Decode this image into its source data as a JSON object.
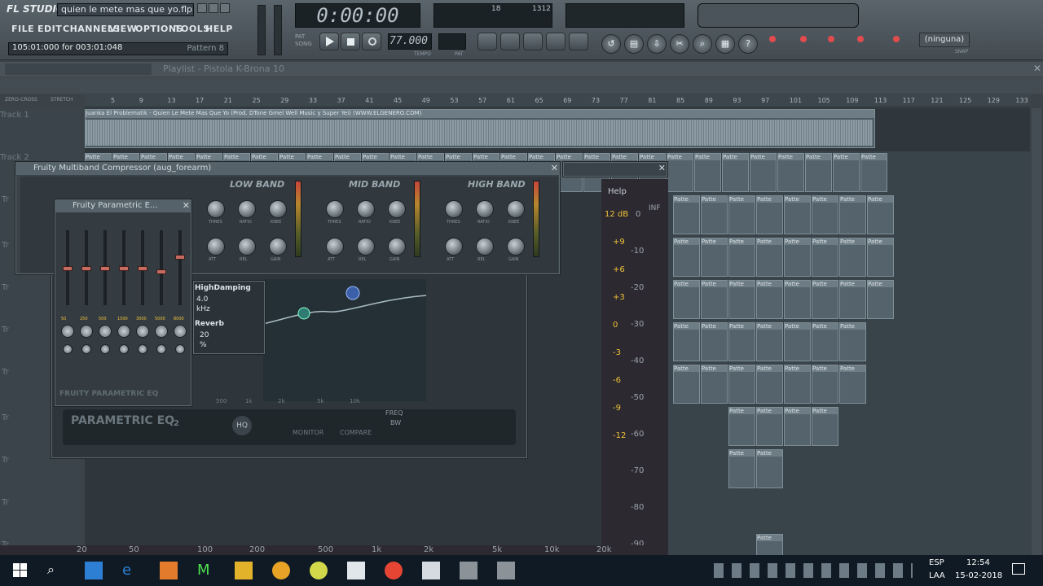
{
  "app": {
    "logo": "FL STUDIO",
    "project_file": "quien le mete mas que yo.flp",
    "time_status": "105:01:000 for 003:01:048",
    "pattern": "Pattern 8",
    "time_display": "0:00:00",
    "tempo": "77.000",
    "snap": "(ninguna)"
  },
  "menu": [
    "FILE",
    "EDIT",
    "CHANNELS",
    "VIEW",
    "OPTIONS",
    "TOOLS",
    "HELP"
  ],
  "mini": {
    "pat": "PAT",
    "song": "SONG",
    "tempo_lbl": "TEMPO",
    "pat_lbl": "PAT",
    "cpu1": "18",
    "cpu2": "1312",
    "snap_sub": "SNAP"
  },
  "playlist": {
    "title": "Playlist - Pistola K-Brona 10",
    "zero_cross": "ZERO-CROSS",
    "stretch": "STRETCH",
    "ruler": [
      "5",
      "9",
      "13",
      "17",
      "21",
      "25",
      "29",
      "33",
      "37",
      "41",
      "45",
      "49",
      "53",
      "57",
      "61",
      "65",
      "69",
      "73",
      "77",
      "81",
      "85",
      "89",
      "93",
      "97",
      "101",
      "105",
      "109",
      "113",
      "117",
      "121",
      "125",
      "129",
      "133"
    ],
    "track1": "Track 1",
    "track2": "Track 2",
    "track_short": "Tr",
    "audio_clip": "Juanka El Problematik - Quien Le Mete Mas Que Yo (Prod. DTone Gmel Well Music y Super Yei) (WWW.ELGENERO.COM)",
    "pattern_clip": "Patte",
    "pattern_short": "Patt"
  },
  "multiband": {
    "title": "Fruity Multiband Compressor (aug_forearm)",
    "bands": [
      "LOW BAND",
      "MID BAND",
      "HIGH BAND"
    ],
    "knob_labels": [
      "THRES",
      "RATIO",
      "KNEE",
      "ATT",
      "REL",
      "GAIN"
    ]
  },
  "parametric_small": {
    "title": "Fruity Parametric E...",
    "freqs": [
      "50",
      "250",
      "500",
      "1500",
      "3000",
      "5000",
      "8000"
    ],
    "logo": "FRUITY PARAMETRIC EQ"
  },
  "reverb": {
    "high_damping": "HighDamping",
    "hd_val1": "4.0",
    "hd_val2": "kHz",
    "reverb": "Reverb",
    "rv_val1": "20",
    "rv_val2": "%"
  },
  "eq2": {
    "logo": "PARAMETRIC EQ",
    "logo_sub": "2",
    "hq": "HQ",
    "monitor": "MONITOR",
    "compare": "COMPARE",
    "freq": "FREQ",
    "bw": "BW",
    "help": "Help",
    "inf": "INF",
    "bottom_ticks": [
      "500",
      "1k",
      "2k",
      "5k",
      "10k"
    ],
    "db_left": [
      "12 dB",
      "+9",
      "+6",
      "+3",
      "0",
      "-3",
      "-6",
      "-9",
      "-12"
    ],
    "db_right": [
      "0",
      "-10",
      "-20",
      "-30",
      "-40",
      "-50",
      "-60",
      "-70",
      "-80",
      "-90"
    ],
    "freq_axis": [
      "20",
      "50",
      "100",
      "200",
      "500",
      "1k",
      "2k",
      "5k",
      "10k",
      "20k"
    ]
  },
  "taskbar": {
    "lang1": "ESP",
    "lang2": "LAA",
    "time": "12:54",
    "date": "15-02-2018"
  }
}
